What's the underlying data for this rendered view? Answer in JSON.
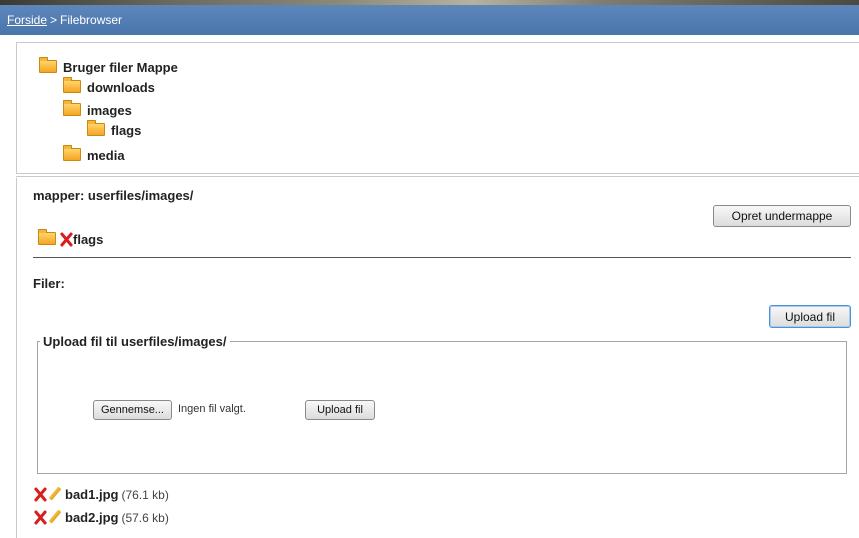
{
  "breadcrumb": {
    "home": "Forside",
    "separator": ">",
    "current": "Filebrowser"
  },
  "tree": {
    "root": "Bruger filer Mappe",
    "children": [
      "downloads",
      "images",
      "flags",
      "media"
    ]
  },
  "folder_section": {
    "heading": "mapper: userfiles/images/",
    "create_button": "Opret undermappe",
    "folders": [
      "flags"
    ]
  },
  "files_section": {
    "heading": "Filer:",
    "upload_toggle_button": "Upload fil"
  },
  "upload_form": {
    "legend_prefix": "Upload fil til ",
    "legend_path": "userfiles/images/",
    "browse_button": "Gennemse...",
    "no_file_text": "Ingen fil valgt.",
    "submit_button": "Upload fil"
  },
  "files": [
    {
      "name": "bad1.jpg",
      "size": "(76.1 kb)"
    },
    {
      "name": "bad2.jpg",
      "size": "(57.6 kb)"
    }
  ],
  "icons": {
    "folder": "folder-icon",
    "delete": "delete-x-icon",
    "rename": "pencil-icon"
  },
  "colors": {
    "breadcrumb_bg": "#5580b5",
    "folder": "#f5a623",
    "delete": "#d81e1e"
  }
}
